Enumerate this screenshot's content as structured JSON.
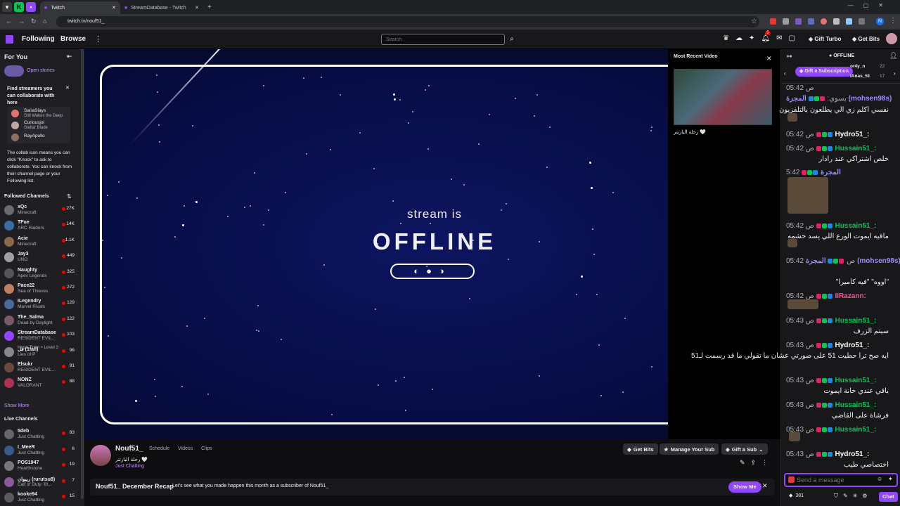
{
  "browser": {
    "tabs": [
      {
        "label": "Twitch",
        "active": true
      },
      {
        "label": "StreamDatabase - Twitch",
        "active": false
      }
    ],
    "url": "twitch.tv/nouf51_"
  },
  "topnav": {
    "following": "Following",
    "browse": "Browse",
    "search_placeholder": "Search",
    "gift_turbo": "Gift Turbo",
    "get_bits": "Get Bits",
    "notif_count": "5"
  },
  "sidebar": {
    "for_you": "For You",
    "open_stories": "Open stories",
    "collab_title": "Find streamers you can collaborate with here",
    "collab_people": [
      {
        "name": "SariaSlays",
        "game": "Still Wakes the Deep"
      },
      {
        "name": "Curiousjoi",
        "game": "Stellar Blade"
      },
      {
        "name": "RayApollo",
        "game": ""
      }
    ],
    "collab_text": "The collab icon means you can click \"Knock\" to ask to collaborate. You can knock from their channel page or your Following list.",
    "followed_title": "Followed Channels",
    "followed": [
      {
        "name": "xQc",
        "game": "Minecraft",
        "viewers": "27K",
        "color": "#6b6b6b"
      },
      {
        "name": "TFue",
        "game": "ARC Raiders",
        "viewers": "14K",
        "color": "#3a6ea5"
      },
      {
        "name": "Acie",
        "game": "Minecraft",
        "viewers": "1.1K",
        "color": "#8a6a4a"
      },
      {
        "name": "Jay3",
        "game": "UNO",
        "viewers": "449",
        "color": "#a0a0a0"
      },
      {
        "name": "Naughty",
        "game": "Apex Legends",
        "viewers": "325",
        "color": "#555"
      },
      {
        "name": "Pace22",
        "game": "Sea of Thieves",
        "viewers": "272",
        "color": "#c08060"
      },
      {
        "name": "ILegendry",
        "game": "Marvel Rivals",
        "viewers": "129",
        "color": "#4a6a9a"
      },
      {
        "name": "The_Salma",
        "game": "Dead by Daylight",
        "viewers": "122",
        "color": "#7a5a6a"
      },
      {
        "name": "StreamDatabase",
        "game": "RESIDENT EVIL...",
        "viewers": "103",
        "color": "#9146ff"
      },
      {
        "name": "فل (1fali)",
        "game": "Lies of P",
        "viewers": "96",
        "color": "#888"
      },
      {
        "name": "Elsukr",
        "game": "RESIDENT EVIL...",
        "viewers": "91",
        "color": "#6a4a3a"
      },
      {
        "name": "NONZ",
        "game": "VALORANT",
        "viewers": "88",
        "color": "#aa3355"
      }
    ],
    "hype_train": "Hype Train • Level 3",
    "show_more": "Show More",
    "live_title": "Live Channels",
    "live": [
      {
        "name": "5deb",
        "game": "Just Chatting",
        "viewers": "83",
        "color": "#666"
      },
      {
        "name": "I_MeeR",
        "game": "Just Chatting",
        "viewers": "6",
        "color": "#3a5a8a"
      },
      {
        "name": "POS1947",
        "game": "Hearthstone",
        "viewers": "19",
        "color": "#777"
      },
      {
        "name": "ربيوان (rurutsu8)",
        "game": "Call of Duty: Bl...",
        "viewers": "7",
        "color": "#8a5a9a"
      },
      {
        "name": "kooke94",
        "game": "Just Chatting",
        "viewers": "15",
        "color": "#5a5a5a"
      }
    ]
  },
  "player": {
    "stream_is": "stream is",
    "offline": "OFFLINE"
  },
  "panel": {
    "title": "Most Recent Video",
    "video_title": "رحلة البارنتر 🤍"
  },
  "channel": {
    "name": "Nouf51_",
    "tabs": [
      "Schedule",
      "Videos",
      "Clips"
    ],
    "status": "رحلة البارنتر 🤍",
    "category": "Just Chatting",
    "get_bits": "Get Bits",
    "manage_sub": "Manage Your Sub",
    "gift_sub": "Gift a Sub"
  },
  "recap": {
    "title": "Nouf51_ December Recap",
    "text": "Let's see what you made happen this month as a subscriber of Nouf51_",
    "button": "Show Me"
  },
  "chat": {
    "offline": "OFFLINE",
    "gift_sub": "Gift a Subscription",
    "leaders": [
      {
        "name": "or4y_n",
        "count": "22"
      },
      {
        "name": "IAnas_51",
        "count": "17"
      }
    ],
    "messages": [
      {
        "time": "",
        "name": "",
        "color": "#adadb8",
        "text": "ص 05:42"
      },
      {
        "time": "بسوي:",
        "name": "المجرة (mohsen98s)",
        "color": "#9b8cff",
        "text": "نفسي اكلم زي الي يطلعون بالتلفزيون"
      },
      {
        "time": "05:42 ص",
        "name": "Hydro51_:",
        "color": "#ffffff",
        "text": ""
      },
      {
        "time": "05:42 ص",
        "name": "Hussain51_:",
        "color": "#00c853",
        "text": "خلص اشتراكي عند رادار"
      },
      {
        "time": "5:42",
        "name": "المجرة",
        "color": "#9b8cff",
        "text": ""
      },
      {
        "time": "05:42 ص",
        "name": "Hussain51_:",
        "color": "#00c853",
        "text": "ماقيه ايموت الورع اللي يسد خشمه"
      },
      {
        "time": "05:42 ص",
        "name": "المجرة (mohsen98s)",
        "color": "#9b8cff",
        "text": "\"اووه\" \"فيه كاميرا\""
      },
      {
        "time": "05:42 ص",
        "name": "IIRazann:",
        "color": "#ff4fa3",
        "text": ""
      },
      {
        "time": "05:43 ص",
        "name": "Hussain51_:",
        "color": "#00c853",
        "text": "سيتم الزرف"
      },
      {
        "time": "05:43 ص",
        "name": "Hydro51_:",
        "color": "#ffffff",
        "text": "ايه صح ترا حطيت 51 على صورتي عشان ما تقولي ما قد رسمت لـ51"
      },
      {
        "time": "05:43 ص",
        "name": "Hussain51_:",
        "color": "#00c853",
        "text": "باقي عندي خانة ايموت"
      },
      {
        "time": "05:43 ص",
        "name": "Hussain51_:",
        "color": "#00c853",
        "text": "فرشاة على القاضي"
      },
      {
        "time": "05:43 ص",
        "name": "Hussain51_:",
        "color": "#00c853",
        "text": ""
      },
      {
        "time": "05:43 ص",
        "name": "Hydro51_:",
        "color": "#ffffff",
        "text": "اختصاصي طيب"
      }
    ],
    "send_placeholder": "Send a message",
    "points": "381",
    "chat_button": "Chat"
  }
}
